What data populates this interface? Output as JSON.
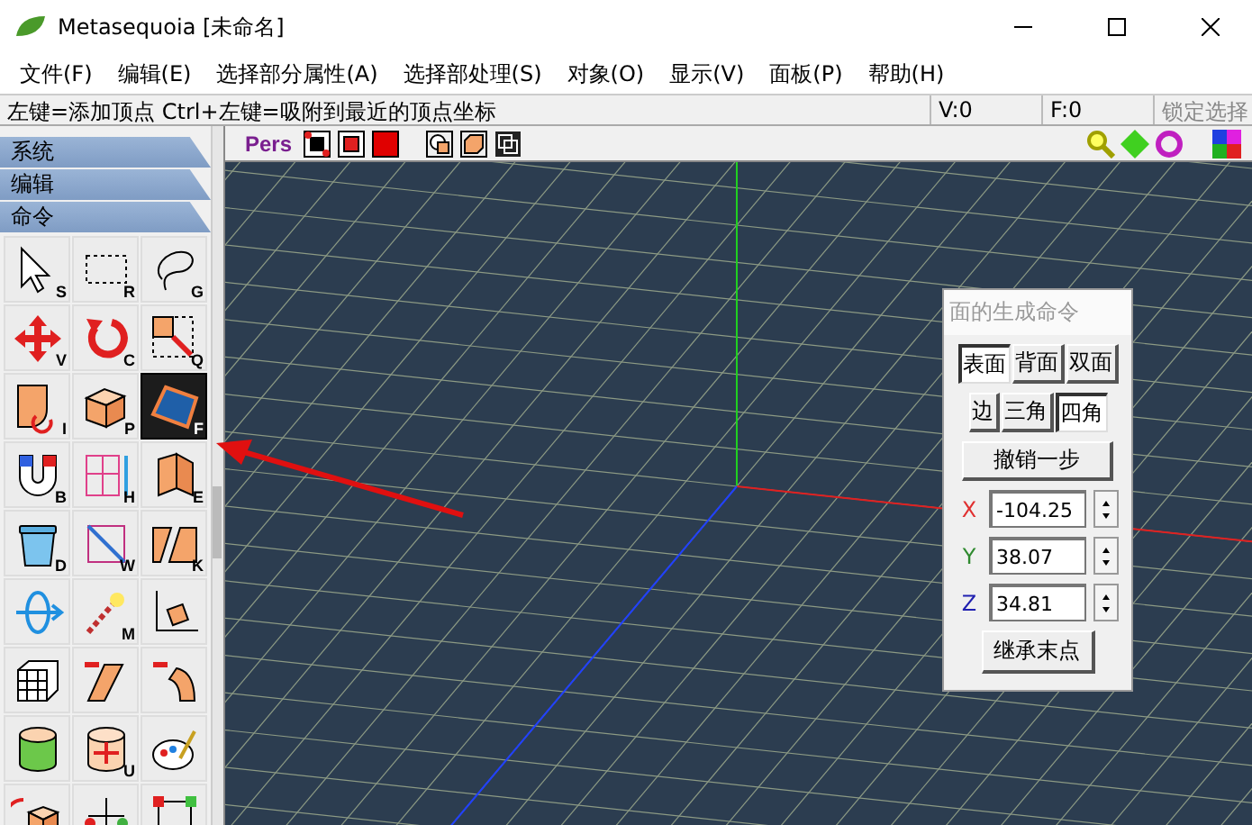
{
  "window": {
    "title": "Metasequoia [未命名]"
  },
  "menu": [
    "文件(F)",
    "编辑(E)",
    "选择部分属性(A)",
    "选择部处理(S)",
    "对象(O)",
    "显示(V)",
    "面板(P)",
    "帮助(H)"
  ],
  "status_bar": {
    "hint": "左键=添加顶点  Ctrl+左键=吸附到最近的顶点坐标",
    "vertices": "V:0",
    "faces": "F:0",
    "lock": "锁定选择"
  },
  "sections": [
    "系统",
    "编辑",
    "命令"
  ],
  "tools": [
    {
      "kind": "pointer",
      "key": "S",
      "selected": false
    },
    {
      "kind": "rect",
      "key": "R",
      "selected": false
    },
    {
      "kind": "lasso",
      "key": "G",
      "selected": false
    },
    {
      "kind": "move",
      "key": "V",
      "selected": false
    },
    {
      "kind": "rotate",
      "key": "C",
      "selected": false
    },
    {
      "kind": "scale",
      "key": "Q",
      "selected": false
    },
    {
      "kind": "face",
      "key": "I",
      "selected": false
    },
    {
      "kind": "box",
      "key": "P",
      "selected": false
    },
    {
      "kind": "plane",
      "key": "F",
      "selected": true
    },
    {
      "kind": "magnet",
      "key": "B",
      "selected": false
    },
    {
      "kind": "knife",
      "key": "H",
      "selected": false
    },
    {
      "kind": "extrude",
      "key": "E",
      "selected": false
    },
    {
      "kind": "trash",
      "key": "D",
      "selected": false
    },
    {
      "kind": "diagonal",
      "key": "W",
      "selected": false
    },
    {
      "kind": "split",
      "key": "K",
      "selected": false
    },
    {
      "kind": "spin",
      "selected": false
    },
    {
      "kind": "wand",
      "key": "M",
      "selected": false
    },
    {
      "kind": "axes",
      "selected": false
    },
    {
      "kind": "lattice",
      "selected": false
    },
    {
      "kind": "slant",
      "selected": false
    },
    {
      "kind": "bend",
      "selected": false
    },
    {
      "kind": "cylinder",
      "selected": false
    },
    {
      "kind": "bulge",
      "key": "U",
      "selected": false
    },
    {
      "kind": "palette",
      "selected": false
    },
    {
      "kind": "twist",
      "selected": false
    },
    {
      "kind": "balance",
      "selected": false
    },
    {
      "kind": "nodes",
      "selected": false
    }
  ],
  "view": {
    "mode": "Pers"
  },
  "panel": {
    "title": "面的生成命令",
    "sides": [
      {
        "label": "表面",
        "selected": true
      },
      {
        "label": "背面",
        "selected": false
      },
      {
        "label": "双面",
        "selected": false
      }
    ],
    "shapes": [
      {
        "label": "边",
        "selected": false
      },
      {
        "label": "三角",
        "selected": false
      },
      {
        "label": "四角",
        "selected": true
      }
    ],
    "undo": "撤销一步",
    "coords": [
      {
        "axis": "X",
        "value": "-104.25",
        "color": "#e03030"
      },
      {
        "axis": "Y",
        "value": "38.07",
        "color": "#2f8a2f"
      },
      {
        "axis": "Z",
        "value": "34.81",
        "color": "#2020b0"
      }
    ],
    "inherit": "继承末点"
  }
}
